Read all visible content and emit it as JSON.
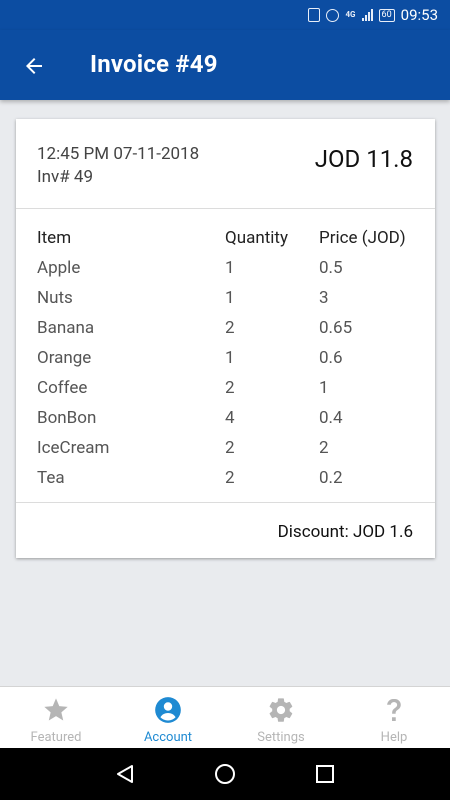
{
  "status_bar": {
    "time": "09:53",
    "network": "4G",
    "battery": "60"
  },
  "header": {
    "title": "Invoice #49"
  },
  "invoice": {
    "datetime": "12:45 PM 07-11-2018",
    "inv_no": "Inv# 49",
    "total": "JOD 11.8",
    "columns": [
      "Item",
      "Quantity",
      "Price (JOD)"
    ],
    "items": [
      {
        "name": "Apple",
        "qty": "1",
        "price": "0.5"
      },
      {
        "name": "Nuts",
        "qty": "1",
        "price": "3"
      },
      {
        "name": "Banana",
        "qty": "2",
        "price": "0.65"
      },
      {
        "name": "Orange",
        "qty": "1",
        "price": "0.6"
      },
      {
        "name": "Coffee",
        "qty": "2",
        "price": "1"
      },
      {
        "name": "BonBon",
        "qty": "4",
        "price": "0.4"
      },
      {
        "name": "IceCream",
        "qty": "2",
        "price": "2"
      },
      {
        "name": "Tea",
        "qty": "2",
        "price": "0.2"
      }
    ],
    "discount": "Discount: JOD 1.6"
  },
  "bottom_nav": {
    "items": [
      {
        "label": "Featured",
        "icon": "star-icon"
      },
      {
        "label": "Account",
        "icon": "account-circle-icon",
        "active": true
      },
      {
        "label": "Settings",
        "icon": "gear-icon"
      },
      {
        "label": "Help",
        "icon": "question-mark-icon"
      }
    ]
  },
  "colors": {
    "primary": "#0c4da2",
    "accent": "#1f8ad2",
    "inactive": "#b5b5b5"
  }
}
